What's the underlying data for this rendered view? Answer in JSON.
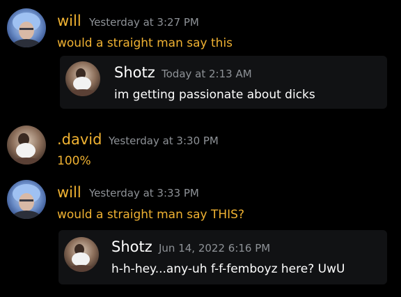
{
  "colors": {
    "username": "#f0b232",
    "message_text": "#f0b232",
    "quoted_name": "#ffffff",
    "quoted_text": "#ffffff",
    "timestamp": "#8e9297",
    "background": "#000000",
    "embed_background": "#111214"
  },
  "messages": [
    {
      "author": "will",
      "timestamp": "Yesterday at 3:27 PM",
      "text": "would a straight man say this",
      "avatar_icon": "blue-hair-avatar-icon",
      "embed": {
        "author": "Shotz",
        "timestamp": "Today at 2:13 AM",
        "text": "im getting passionate about dicks",
        "avatar_icon": "shotz-avatar-icon"
      }
    },
    {
      "author": ".david",
      "timestamp": "Yesterday at 3:30 PM",
      "text": "100%",
      "avatar_icon": "david-avatar-icon"
    },
    {
      "author": "will",
      "timestamp": "Yesterday at 3:33 PM",
      "text": "would a straight man say THIS?",
      "avatar_icon": "blue-hair-avatar-icon",
      "embed": {
        "author": "Shotz",
        "timestamp": "Jun 14, 2022 6:16 PM",
        "text": "h-h-hey...any-uh f-f-femboyz here? UwU",
        "avatar_icon": "shotz-avatar-icon"
      }
    }
  ]
}
